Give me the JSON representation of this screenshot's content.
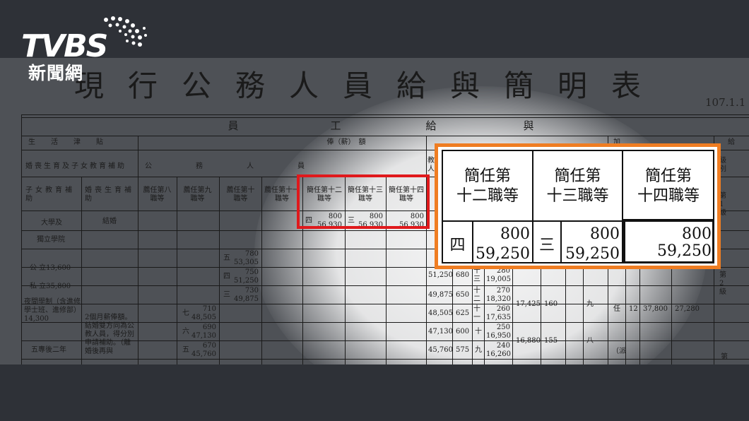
{
  "logo": {
    "brand": "TVBS",
    "subtitle": "新聞網"
  },
  "document": {
    "title": "現行公務人員給與簡明表",
    "date": "107.1.1",
    "header_employee_pay": [
      "員",
      "工",
      "給",
      "與"
    ],
    "col_life": "生　活　津　貼",
    "col_salary": "俸（薪）　額",
    "col_add": "加",
    "col_give": "給",
    "row_wedding": "婚喪生育及子女教育補助",
    "row_public": "公　　務　　人　　員",
    "col_teacher": "教人",
    "col_level": "級別",
    "child_edu": "子女教育補助",
    "wedding_funeral": "婚喪生育補助",
    "grades": [
      "薦任第八職等",
      "薦任第九職等",
      "薦任第十職等",
      "薦任第十一職等",
      "簡任第十二職等",
      "簡任第十三職等",
      "簡任第十四職等"
    ],
    "level1": "第1級",
    "level2": "第2級",
    "level3": "第",
    "university": "大學及",
    "college": "獨立學院",
    "marriage": "結婚",
    "public_fee": "公 立13,600",
    "private_fee": "私 立35,800",
    "night": "夜間學制（含進修學士班、進修部）14,300",
    "five_year": "五專後二年",
    "marriage_rule": "2個月薪俸額。結婚雙方同為公教人員，得分別申請補助。（離婚後再與",
    "ren": "任",
    "pai": "（派",
    "rows": [
      {
        "tag": "五",
        "v1": "780",
        "v2": "53,305"
      },
      {
        "tag": "四",
        "v1": "750",
        "v2": "51,250"
      },
      {
        "tag": "三",
        "v1": "730",
        "v2": "49,875"
      },
      {
        "tag": "七",
        "v1": "710",
        "v2": "48,505"
      },
      {
        "tag": "六",
        "v1": "690",
        "v2": "47,130"
      },
      {
        "tag": "五",
        "v1": "670",
        "v2": "45,760"
      }
    ],
    "top_row": {
      "tag1": "四",
      "v1a": "800",
      "v1b": "56,930",
      "tag2": "三",
      "v2a": "800",
      "v2b": "56,930",
      "v3a": "800",
      "v3b": "56,930"
    },
    "right_cols": [
      {
        "a": "51,250",
        "b": "680",
        "c": "十三",
        "d": "280",
        "e": "19,005"
      },
      {
        "a": "49,875",
        "b": "650",
        "c": "十二",
        "d": "270",
        "e": "18,320"
      },
      {
        "a": "48,505",
        "b": "625",
        "c": "十一",
        "d": "260",
        "e": "17,635"
      },
      {
        "a": "47,130",
        "b": "600",
        "c": "十",
        "d": "250",
        "e": "16,950"
      },
      {
        "a": "45,760",
        "b": "575",
        "c": "九",
        "d": "240",
        "e": "16,260"
      }
    ],
    "extra1": {
      "a": "17,425",
      "b": "160",
      "c": "九"
    },
    "extra2": {
      "a": "16,880",
      "b": "155",
      "c": "八"
    },
    "extra3": {
      "a": "12",
      "b": "37,800",
      "c": "27,280"
    }
  },
  "zoom": {
    "headers": [
      "簡任第\n十二職等",
      "簡任第\n十三職等",
      "簡任第\n十四職等"
    ],
    "tag1": "四",
    "v1a": "800",
    "v1b": "59,250",
    "tag2": "三",
    "v2a": "800",
    "v2b": "59,250",
    "v3a": "800",
    "v3b": "59,250"
  },
  "colors": {
    "highlight_red": "#e0191c",
    "highlight_orange": "#ef7d22"
  }
}
